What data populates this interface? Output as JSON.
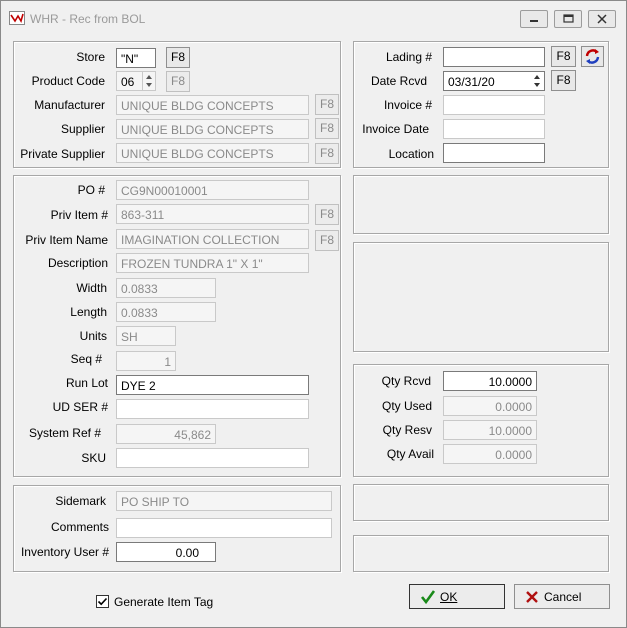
{
  "window": {
    "title": "WHR - Rec from BOL"
  },
  "store": {
    "label": "Store",
    "value": "\"N\""
  },
  "product_code": {
    "label": "Product Code",
    "value": "06"
  },
  "manufacturer": {
    "label": "Manufacturer",
    "value": "UNIQUE BLDG CONCEPTS"
  },
  "supplier": {
    "label": "Supplier",
    "value": "UNIQUE BLDG CONCEPTS"
  },
  "private_supplier": {
    "label": "Private Supplier",
    "value": "UNIQUE BLDG CONCEPTS"
  },
  "f8": "F8",
  "lading": {
    "label": "Lading #",
    "value": ""
  },
  "date_rcvd": {
    "label": "Date Rcvd",
    "value": "03/31/20"
  },
  "invoice": {
    "label": "Invoice #",
    "value": ""
  },
  "invoice_date": {
    "label": "Invoice Date",
    "value": ""
  },
  "location": {
    "label": "Location",
    "value": ""
  },
  "item": {
    "po": {
      "label": "PO #",
      "value": "CG9N00010001"
    },
    "priv_item": {
      "label": "Priv Item #",
      "value": "863-311"
    },
    "priv_item_name": {
      "label": "Priv Item Name",
      "value": "IMAGINATION COLLECTION"
    },
    "description": {
      "label": "Description",
      "value": "FROZEN TUNDRA 1\" X 1\""
    },
    "width": {
      "label": "Width",
      "value": "0.0833"
    },
    "length": {
      "label": "Length",
      "value": "0.0833"
    },
    "units": {
      "label": "Units",
      "value": "SH"
    },
    "seq": {
      "label": "Seq #",
      "value": "1"
    },
    "run_lot": {
      "label": "Run Lot",
      "value": "DYE 2"
    },
    "ud_ser": {
      "label": "UD SER #",
      "value": ""
    },
    "system_ref": {
      "label": "System Ref #",
      "value": "45,862"
    },
    "sku": {
      "label": "SKU",
      "value": ""
    }
  },
  "qty": {
    "rcvd": {
      "label": "Qty Rcvd",
      "value": "10.0000"
    },
    "used": {
      "label": "Qty Used",
      "value": "0.0000"
    },
    "resv": {
      "label": "Qty Resv",
      "value": "10.0000"
    },
    "avail": {
      "label": "Qty Avail",
      "value": "0.0000"
    }
  },
  "bottom": {
    "sidemark": {
      "label": "Sidemark",
      "value": "PO SHIP TO"
    },
    "comments": {
      "label": "Comments",
      "value": ""
    },
    "inventory_user": {
      "label": "Inventory User #",
      "value": "0.00"
    }
  },
  "generate_tag": {
    "label": "Generate Item Tag",
    "checked": true
  },
  "ok_label": "OK",
  "cancel_label": "Cancel"
}
